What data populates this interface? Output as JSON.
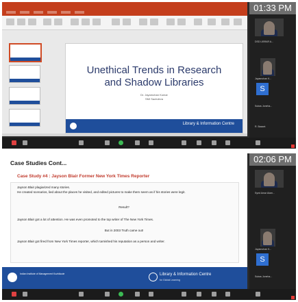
{
  "frame1": {
    "slide": {
      "title_line1": "Unethical Trends in Research",
      "title_line2": "and Shadow  Libraries",
      "author_line1": "Dr. Jayamohan Kumar",
      "author_line2": "SMI Sachdeva",
      "footer_text": "Library & Information Centre"
    },
    "sidebar": {
      "clock": "01:33 PM",
      "participant_1": "DSD LIBRAR A...",
      "participant_2": "Jayamohan K...",
      "participant_s": "S",
      "participant_3": "Subas Joneha...",
      "participant_4": "R. Basant"
    }
  },
  "frame2": {
    "slide": {
      "title": "Case Studies Cont...",
      "subtitle": "Case Study #4 : Jayson Blair Former New York Times Reporter",
      "lines": [
        "Jayson Blair plagiarized many stories.",
        "He created scenarios, lied about the places he visited, and edited pictures to make them seem as if his stories were legit.",
        "Result?",
        "Jayson Blair got a lot of attention. He was even promoted to the top writer of The New York Times.",
        "But in 2003 Truth came out!",
        "Jayson Blair got fired from New York Times reporter, which tarnished his reputation as a person and writer."
      ],
      "footer_institute": "Indian Institute of Management Kozhikode",
      "footer_lic": "Library & Information Centre",
      "footer_lic_sub": "for Global Learning"
    },
    "sidebar": {
      "clock": "02:06 PM",
      "participant_1": "Syed Amar Alam...",
      "participant_2": "Jayamohan K...",
      "participant_s": "S",
      "participant_3": "Subas Joneha..."
    }
  }
}
